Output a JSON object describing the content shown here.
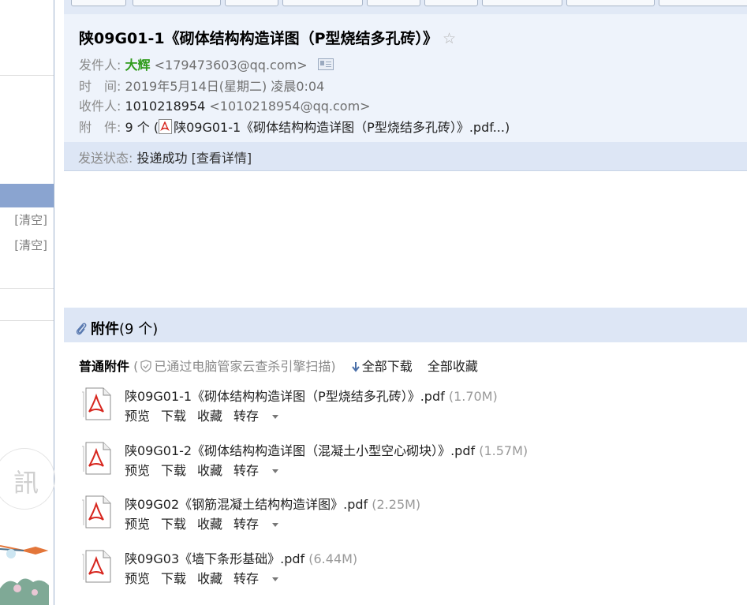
{
  "sidebar": {
    "clear_labels": [
      "[清空]",
      "[清空]"
    ]
  },
  "email": {
    "subject": "陕09G01-1《砌体结构构造详图（P型烧结多孔砖）》",
    "from_label": "发件人:",
    "from_name": "大辉",
    "from_email": "<179473603@qq.com>",
    "time_label": "时　间:",
    "time_value": "2019年5月14日(星期二) 凌晨0:04",
    "to_label": "收件人:",
    "to_name": "1010218954",
    "to_email": "<1010218954@qq.com>",
    "attach_label": "附　件:",
    "attach_count_prefix": "9 个 (",
    "attach_first": "陕09G01-1《砌体结构构造详图（P型烧结多孔砖）》.pdf...)",
    "status_label": "发送状态:",
    "status_value": "投递成功",
    "status_detail": "[查看详情]"
  },
  "attachments": {
    "title": "附件",
    "count": "(9 个)",
    "kind_label": "普通附件",
    "scan_open": "(",
    "scan_text": "已通过电脑管家云查杀引擎扫描)",
    "download_all": "全部下载",
    "save_all": "全部收藏",
    "action_labels": {
      "preview": "预览",
      "download": "下载",
      "favorite": "收藏",
      "save_to": "转存"
    },
    "files": [
      {
        "name": "陕09G01-1《砌体结构构造详图（P型烧结多孔砖）》.pdf",
        "size": "(1.70M)"
      },
      {
        "name": "陕09G01-2《砌体结构构造详图（混凝土小型空心砌块）》.pdf",
        "size": "(1.57M)"
      },
      {
        "name": "陕09G02《钢筋混凝土结构构造详图》.pdf",
        "size": "(2.25M)"
      },
      {
        "name": "陕09G03《墙下条形基础》.pdf",
        "size": "(6.44M)"
      }
    ]
  },
  "colors": {
    "accent_green": "#2e9b1a",
    "header_bg": "#eef3fb",
    "bar_bg": "#dde6f5",
    "sidebar_active": "#8aa4d0"
  }
}
